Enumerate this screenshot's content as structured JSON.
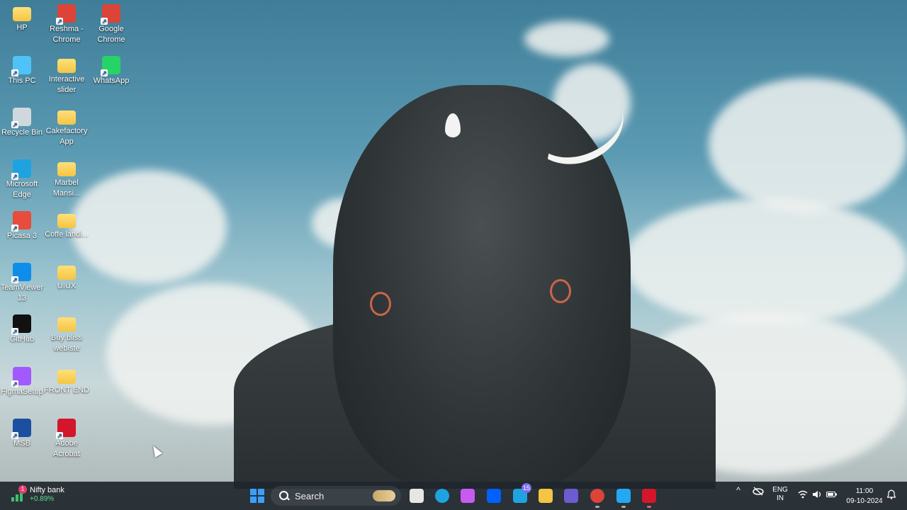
{
  "desktop": {
    "icons": [
      {
        "label": "HP",
        "icon": "folder-icon",
        "color": "#f4c542"
      },
      {
        "label": "Reshma - Chrome",
        "icon": "chrome-icon",
        "color": "#db4437"
      },
      {
        "label": "Google Chrome",
        "icon": "chrome-icon",
        "color": "#db4437"
      },
      {
        "label": "This PC",
        "icon": "monitor-icon",
        "color": "#4fc3f7"
      },
      {
        "label": "Interactive slider",
        "icon": "folder-icon",
        "color": "#f4c542"
      },
      {
        "label": "WhatsApp",
        "icon": "whatsapp-icon",
        "color": "#25d366"
      },
      {
        "label": "Recycle Bin",
        "icon": "recycle-bin-icon",
        "color": "#cfd8dc"
      },
      {
        "label": "Cakefactory App",
        "icon": "folder-icon",
        "color": "#f4c542"
      },
      {
        "label": "Microsoft Edge",
        "icon": "edge-icon",
        "color": "#1fa3e0"
      },
      {
        "label": "Marbel Mansi...",
        "icon": "folder-icon",
        "color": "#f4c542"
      },
      {
        "label": "Picasa 3",
        "icon": "picasa-icon",
        "color": "#e84c3d"
      },
      {
        "label": "Coffe landi...",
        "icon": "folder-icon",
        "color": "#f4c542"
      },
      {
        "label": "TeamViewer 13",
        "icon": "teamviewer-icon",
        "color": "#0e8ee9"
      },
      {
        "label": "UIUX",
        "icon": "folder-icon",
        "color": "#f4c542"
      },
      {
        "label": "GitHub",
        "icon": "github-icon",
        "color": "#111111"
      },
      {
        "label": "Buy bliss webiste",
        "icon": "folder-icon",
        "color": "#f4c542"
      },
      {
        "label": "FigmaSetup",
        "icon": "figma-icon",
        "color": "#a259ff"
      },
      {
        "label": "FRONT END",
        "icon": "folder-icon",
        "color": "#f4c542"
      },
      {
        "label": "MSB",
        "icon": "msb-icon",
        "color": "#1b4fa0"
      },
      {
        "label": "Adobe Acrobat",
        "icon": "acrobat-icon",
        "color": "#d4162a"
      }
    ]
  },
  "taskbar": {
    "widget": {
      "title": "Nifty bank",
      "change": "+0.89%",
      "badge": "1"
    },
    "search": {
      "label": "Search"
    },
    "apps": [
      {
        "name": "start",
        "icon": "windows-start-icon",
        "color": "#3aa0ff"
      },
      {
        "name": "task-view",
        "icon": "task-view-icon",
        "color": "#e6e6e6"
      },
      {
        "name": "edge",
        "icon": "edge-icon",
        "color": "#1fa3e0"
      },
      {
        "name": "copilot",
        "icon": "copilot-icon",
        "color": "#c85af0"
      },
      {
        "name": "dropbox",
        "icon": "dropbox-icon",
        "color": "#0061ff"
      },
      {
        "name": "mail",
        "icon": "mail-icon",
        "color": "#1fa3e0",
        "badge": "15"
      },
      {
        "name": "file-explorer",
        "icon": "folder-icon",
        "color": "#f4c542"
      },
      {
        "name": "media-player",
        "icon": "media-player-icon",
        "color": "#6d5bd0"
      },
      {
        "name": "chrome",
        "icon": "chrome-icon",
        "color": "#db4437"
      },
      {
        "name": "vscode",
        "icon": "vscode-icon",
        "color": "#23a9f2"
      },
      {
        "name": "acrobat",
        "icon": "acrobat-icon",
        "color": "#d4162a"
      }
    ],
    "tray": {
      "lang_top": "ENG",
      "lang_bottom": "IN",
      "time": "11:00",
      "date": "09-10-2024"
    }
  }
}
